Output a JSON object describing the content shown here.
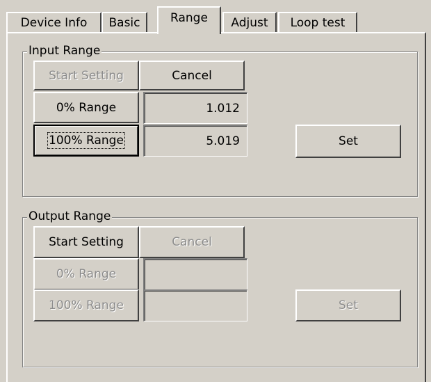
{
  "tabs": {
    "device_info": "Device Info",
    "basic": "Basic",
    "range": "Range",
    "adjust": "Adjust",
    "loop_test": "Loop test",
    "active": "Range"
  },
  "input_range": {
    "title": "Input Range",
    "start_setting": "Start Setting",
    "start_setting_enabled": false,
    "cancel": "Cancel",
    "cancel_enabled": true,
    "zero_range": "0% Range",
    "zero_value": "1.012",
    "hundred_range": "100% Range",
    "hundred_value": "5.019",
    "set": "Set",
    "set_enabled": true
  },
  "output_range": {
    "title": "Output Range",
    "start_setting": "Start Setting",
    "start_setting_enabled": true,
    "cancel": "Cancel",
    "cancel_enabled": false,
    "zero_range": "0% Range",
    "zero_value": "",
    "hundred_range": "100% Range",
    "hundred_value": "",
    "set": "Set",
    "set_enabled": false
  }
}
